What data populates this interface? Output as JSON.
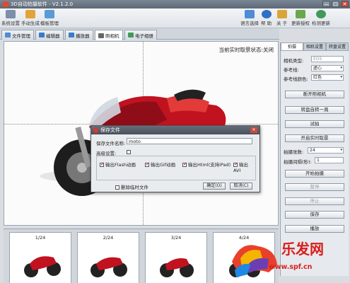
{
  "window": {
    "title": "3D自动拍摄软件 - V2.1.2.0",
    "controls": [
      "—",
      "□",
      "✕"
    ]
  },
  "toolbar_left": [
    {
      "label": "系统设置",
      "icon": "gear-icon",
      "color": "#7b8fa8"
    },
    {
      "label": "手动生成",
      "icon": "hand-icon",
      "color": "#e3a33b"
    },
    {
      "label": "模板管理",
      "icon": "template-icon",
      "color": "#5a9bd4"
    }
  ],
  "toolbar_right": [
    {
      "label": "语言选择",
      "icon": "language-icon",
      "color": "#4f8bd6"
    },
    {
      "label": "帮 助",
      "icon": "help-icon",
      "color": "#2f6fc4"
    },
    {
      "label": "关 于",
      "icon": "about-icon",
      "color": "#d9a43a"
    },
    {
      "label": "更新授权",
      "icon": "license-icon",
      "color": "#6aa84f"
    },
    {
      "label": "检测更新",
      "icon": "update-icon",
      "color": "#3f9b57"
    }
  ],
  "tabs": [
    {
      "label": "文件管理",
      "icon": "folder-icon",
      "color": "#4f8bd6"
    },
    {
      "label": "编辑器",
      "icon": "editor-icon",
      "color": "#3a7bc8"
    },
    {
      "label": "播放器",
      "icon": "player-icon",
      "color": "#3a7bc8"
    },
    {
      "label": "照相机",
      "icon": "camera-icon",
      "color": "#666666"
    },
    {
      "label": "电子相册",
      "icon": "album-icon",
      "color": "#3f9b57"
    }
  ],
  "viewer": {
    "status": "当前实时取景状态:关闭"
  },
  "dialog": {
    "title": "保存文件",
    "filename_label": "保存文件名称:",
    "filename_value": "moto",
    "advanced_label": "高级设置:",
    "options": [
      {
        "label": "输出Flash动画",
        "checked": true
      },
      {
        "label": "输出Gif动画",
        "checked": true
      },
      {
        "label": "输出Html(支持iPad)",
        "checked": true
      },
      {
        "label": "输出AVI",
        "checked": true
      }
    ],
    "delete_temp_label": "删除临时文件",
    "ok_label": "确定(O)",
    "cancel_label": "取消(C)"
  },
  "right_panel": {
    "tabs": [
      "拍摄",
      "相机设置",
      "转盘设置"
    ],
    "camera_type_label": "相机类型:",
    "camera_type_value": "EOS",
    "ref_line_label": "参考线:",
    "ref_line_value": "虚心",
    "ref_color_label": "参考线颜色:",
    "ref_color_value": "红色",
    "btn_connect": "断开照相机",
    "btn_rotate": "转盘自转一周",
    "btn_test": "试拍",
    "btn_live": "开启实时取景",
    "shots_label": "拍摄张数:",
    "shots_value": "24",
    "interval_label": "拍摄间隔(秒):",
    "interval_value": "1",
    "btn_start": "开始拍摄",
    "btn_pause": "暂停",
    "btn_stop": "停止",
    "btn_save": "保存",
    "btn_play": "播放"
  },
  "thumbnails": [
    "1/24",
    "2/24",
    "3/24",
    "4/24"
  ],
  "watermark": {
    "text": "乐发网",
    "url": "www.spf.cn"
  }
}
